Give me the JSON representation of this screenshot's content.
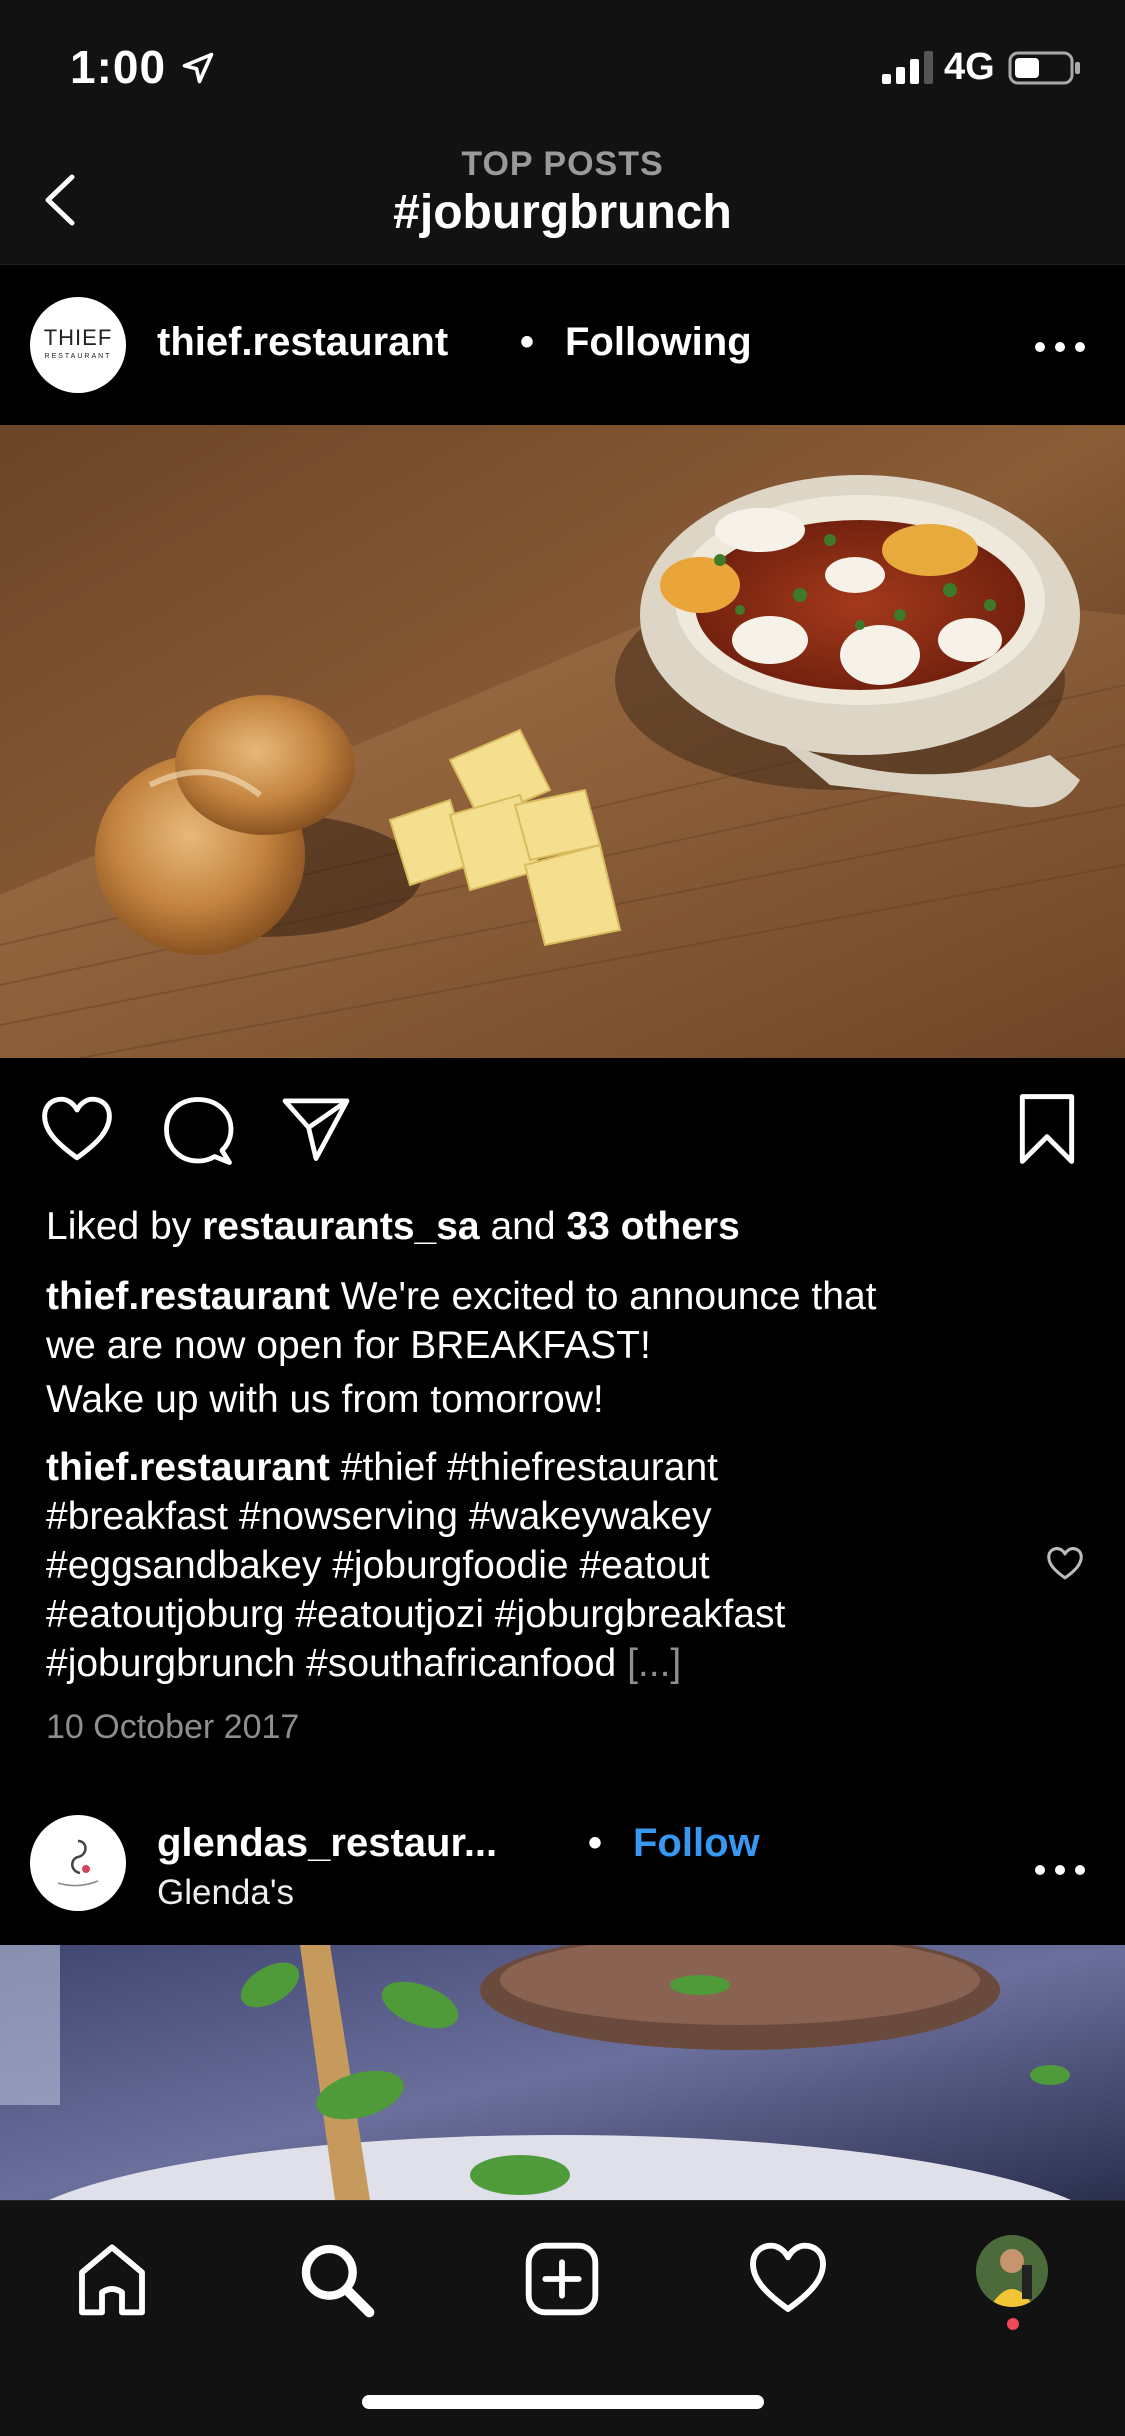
{
  "status_bar": {
    "time": "1:00",
    "network": "4G"
  },
  "header": {
    "subtitle": "TOP POSTS",
    "title": "#joburgbrunch"
  },
  "posts": [
    {
      "avatar_text": "THIEF",
      "avatar_subtext": "RESTAURANT",
      "username": "thief.restaurant",
      "separator": "•",
      "follow_state": "Following",
      "likes": {
        "prefix": "Liked by",
        "user": "restaurants_sa",
        "and": "and",
        "others": "33 others"
      },
      "caption": {
        "username": "thief.restaurant",
        "line1": "We're excited to announce that",
        "line2": "we are now open for BREAKFAST!",
        "line3": "Wake up with us from tomorrow!"
      },
      "comment": {
        "username": "thief.restaurant",
        "line1": "#thief #thiefrestaurant",
        "line2": "#breakfast #nowserving #wakeywakey",
        "line3": "#eggsandbakey #joburgfoodie #eatout",
        "line4": "#eatoutjoburg #eatoutjozi #joburgbreakfast",
        "line5": "#joburgbrunch #southafricanfood",
        "more": "[...]"
      },
      "date": "10 October 2017"
    },
    {
      "username": "glendas_restaur...",
      "separator": "•",
      "follow_state": "Follow",
      "subtitle": "Glenda's"
    }
  ],
  "colors": {
    "background": "#000000",
    "bar": "#121212",
    "follow_blue": "#3897f0",
    "muted": "#8e8e8e"
  },
  "icons": {
    "status": [
      "location-arrow-icon",
      "signal-icon",
      "battery-icon"
    ],
    "nav": [
      "back-chevron-icon"
    ],
    "actions": [
      "heart-icon",
      "comment-icon",
      "share-icon",
      "bookmark-icon",
      "more-icon"
    ],
    "tabs": [
      "home-icon",
      "search-icon",
      "add-post-icon",
      "activity-heart-icon",
      "profile-avatar-icon"
    ]
  }
}
